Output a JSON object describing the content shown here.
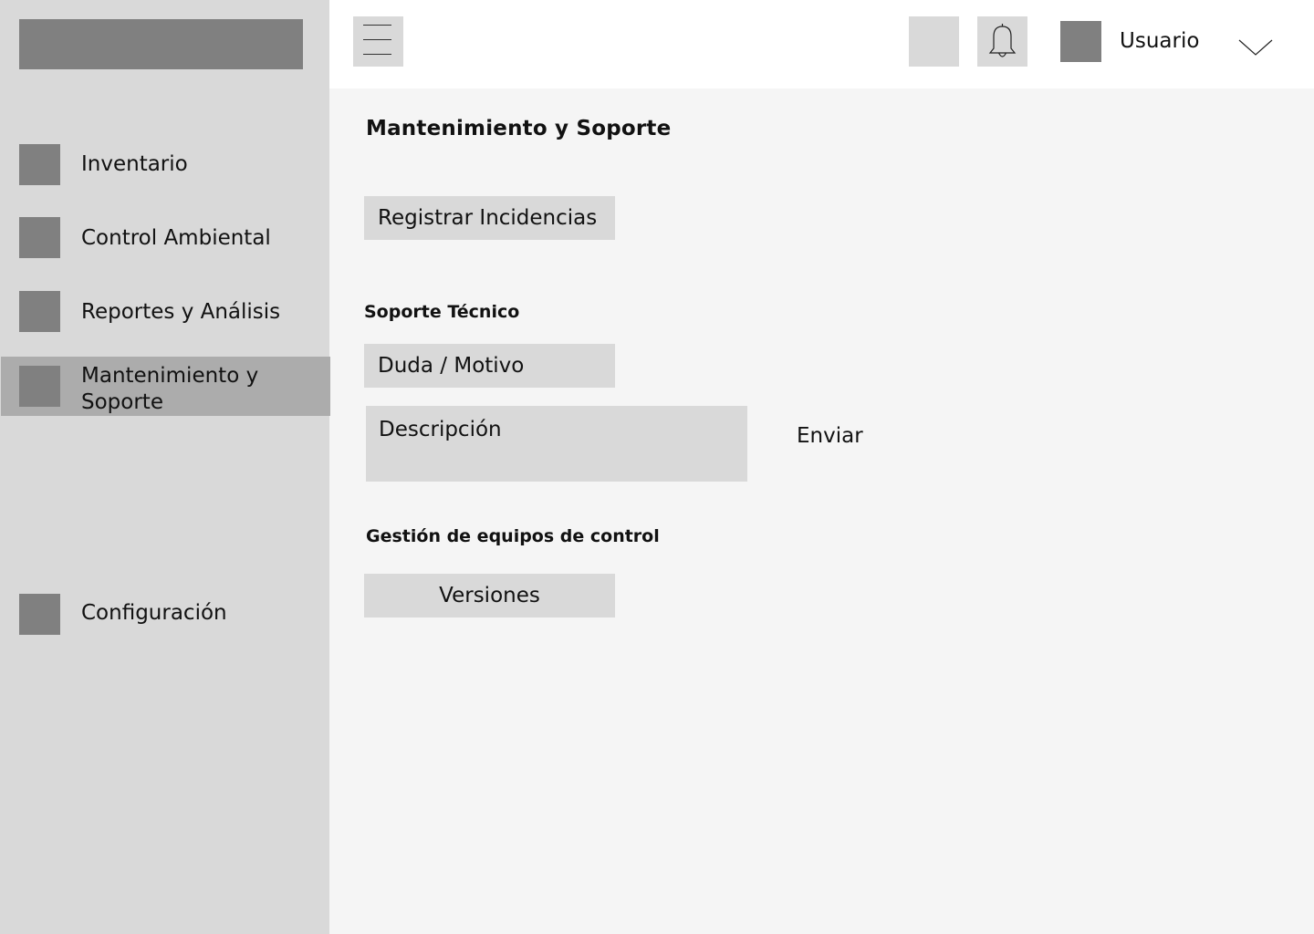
{
  "sidebar": {
    "items": [
      {
        "label": "Inventario"
      },
      {
        "label": "Control Ambiental"
      },
      {
        "label": "Reportes y Análisis"
      },
      {
        "label": "Mantenimiento y Soporte"
      },
      {
        "label": "Configuración"
      }
    ],
    "active_index": 3
  },
  "topbar": {
    "user_name": "Usuario",
    "icons": [
      "menu-icon",
      "bell-icon",
      "chevron-down-icon"
    ]
  },
  "main": {
    "title": "Mantenimiento y Soporte",
    "register_button": "Registrar Incidencias",
    "support": {
      "title": "Soporte Técnico",
      "reason_field": "Duda / Motivo",
      "description_field": "Descripción",
      "send_button": "Enviar"
    },
    "equipment": {
      "title": "Gestión de equipos de control",
      "versions_button": "Versiones"
    }
  }
}
